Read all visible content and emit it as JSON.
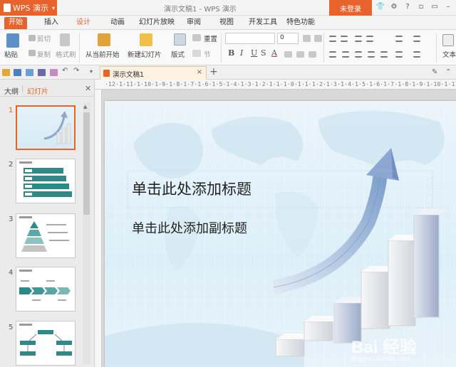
{
  "app": {
    "name": "WPS 演示",
    "doc_title": "演示文稿1 - WPS 演示",
    "login_label": "未登录"
  },
  "menu": {
    "tabs": [
      "开始",
      "插入",
      "设计",
      "动画",
      "幻灯片放映",
      "审阅",
      "视图",
      "开发工具",
      "特色功能"
    ]
  },
  "ribbon": {
    "paste": "粘贴",
    "cut": "剪切",
    "copy": "复制",
    "format_painter": "格式刷",
    "from_current": "从当前开始",
    "new_slide": "新建幻灯片",
    "layout": "版式",
    "reset": "重置",
    "section": "节",
    "font_size": "0",
    "bold": "B",
    "italic": "I",
    "underline": "U",
    "shadow": "S",
    "font_color": "A",
    "text_box": "文本"
  },
  "doc_tab": {
    "label": "演示文稿1"
  },
  "panel": {
    "tab_outline": "大纲",
    "tab_slides": "幻灯片",
    "slide_numbers": [
      "1",
      "2",
      "3",
      "4",
      "5"
    ]
  },
  "ruler": {
    "labels": "·12·1·11·1·10·1·9·1·8·1·7·1·6·1·5·1·4·1·3·1·2·1·1·1·0·1·1·1·2·1·3·1·4·1·5·1·6·1·7·1·8·1·9·1·10·1·11·1·12·1·"
  },
  "slide": {
    "title_placeholder": "单击此处添加标题",
    "subtitle_placeholder": "单击此处添加副标题"
  },
  "watermark": {
    "brand": "Bai 经验",
    "url": "jingyan.baidu.com"
  },
  "colors": {
    "accent": "#e8632b",
    "tab_text": "#333333",
    "slide_bg": "#dceff8"
  }
}
